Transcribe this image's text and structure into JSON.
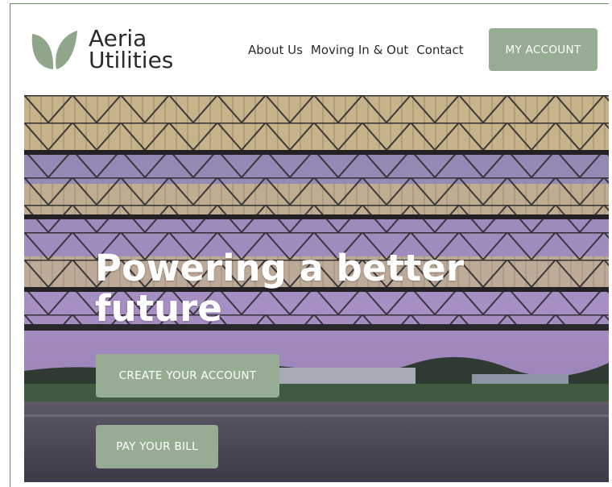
{
  "brand": {
    "line1": "Aeria",
    "line2": "Utilities"
  },
  "nav": {
    "items": [
      "About Us",
      "Moving In & Out",
      "Contact"
    ]
  },
  "header": {
    "account_label": "MY ACCOUNT"
  },
  "hero": {
    "headline_line1": "Powering a better",
    "headline_line2": "future",
    "create_label": "CREATE YOUR ACCOUNT",
    "pay_label": "PAY YOUR BILL"
  },
  "colors": {
    "accent": "#97ad93",
    "logo_leaf": "#8fa68a",
    "frame": "#6f8a66",
    "text": "#2a2a2a"
  }
}
